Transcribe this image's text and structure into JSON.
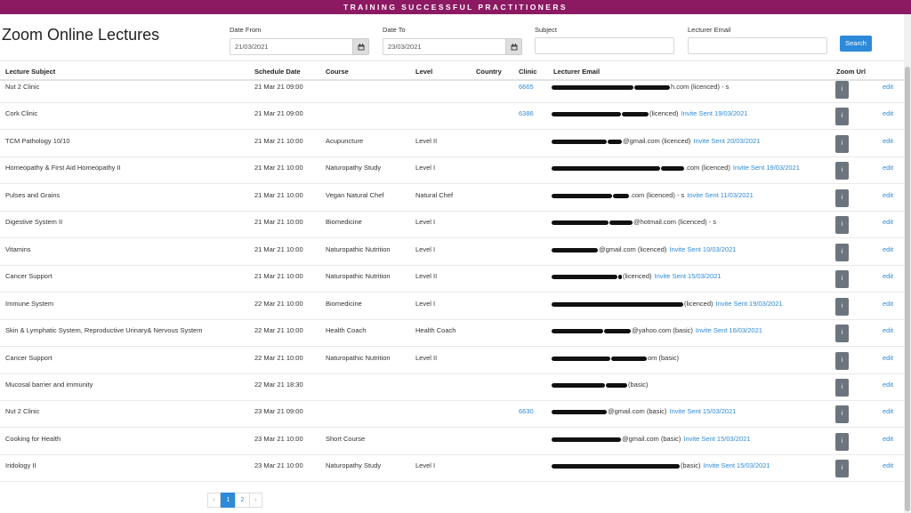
{
  "banner": "TRAINING SUCCESSFUL PRACTITIONERS",
  "page_title": "Zoom Online Lectures",
  "filters": {
    "date_from_label": "Date From",
    "date_from_value": "21/03/2021",
    "date_to_label": "Date To",
    "date_to_value": "23/03/2021",
    "subject_label": "Subject",
    "subject_value": "",
    "lecturer_email_label": "Lecturer Email",
    "lecturer_email_value": "",
    "search_label": "Search"
  },
  "columns": {
    "subject": "Lecture Subject",
    "date": "Schedule Date",
    "course": "Course",
    "level": "Level",
    "country": "Country",
    "clinic": "Clinic",
    "email": "Lecturer Email",
    "zoom": "Zoom Url"
  },
  "zoom_button_label": "i",
  "edit_label": "edit",
  "rows": [
    {
      "subject": "Nut 2 Clinic",
      "date": "21 Mar 21 09:00",
      "course": "",
      "level": "",
      "country": "",
      "clinic": "6665",
      "email_suffix": "h.com (licenced) - s",
      "invite": ""
    },
    {
      "subject": "Cork Clinic",
      "date": "21 Mar 21 09:00",
      "course": "",
      "level": "",
      "country": "",
      "clinic": "6386",
      "email_suffix": "(licenced)",
      "invite": "Invite Sent 19/03/2021"
    },
    {
      "subject": "TCM Pathology 10/10",
      "date": "21 Mar 21 10:00",
      "course": "Acupuncture",
      "level": "Level II",
      "country": "",
      "clinic": "",
      "email_suffix": "@gmail.com (licenced)",
      "invite": "Invite Sent 20/03/2021"
    },
    {
      "subject": "Homeopathy & First Aid Homeopathy II",
      "date": "21 Mar 21 10:00",
      "course": "Naturopathy Study",
      "level": "Level I",
      "country": "",
      "clinic": "",
      "email_suffix": ".com (licenced)",
      "invite": "Invite Sent 19/03/2021"
    },
    {
      "subject": "Pulses and Grains",
      "date": "21 Mar 21 10:00",
      "course": "Vegan Natural Chef",
      "level": "Natural Chef",
      "country": "",
      "clinic": "",
      "email_suffix": ".com (licenced) - s",
      "invite": "Invite Sent 11/03/2021"
    },
    {
      "subject": "Digestive System II",
      "date": "21 Mar 21 10:00",
      "course": "Biomedicine",
      "level": "Level I",
      "country": "",
      "clinic": "",
      "email_suffix": "@hotmail.com (licenced) - s",
      "invite": ""
    },
    {
      "subject": "Vitamins",
      "date": "21 Mar 21 10:00",
      "course": "Naturopathic Nutrition",
      "level": "Level I",
      "country": "",
      "clinic": "",
      "email_suffix": "@gmail.com (licenced)",
      "invite": "Invite Sent 10/03/2021"
    },
    {
      "subject": "Cancer Support",
      "date": "21 Mar 21 10:00",
      "course": "Naturopathic Nutrition",
      "level": "Level II",
      "country": "",
      "clinic": "",
      "email_suffix": "(licenced)",
      "invite": "Invite Sent 15/03/2021"
    },
    {
      "subject": "Immune System",
      "date": "22 Mar 21 10:00",
      "course": "Biomedicine",
      "level": "Level I",
      "country": "",
      "clinic": "",
      "email_suffix": "(licenced)",
      "invite": "Invite Sent 19/03/2021"
    },
    {
      "subject": "Skin & Lymphatic System, Reproductive Urinary& Nervous System",
      "date": "22 Mar 21 10:00",
      "course": "Health Coach",
      "level": "Health Coach",
      "country": "",
      "clinic": "",
      "email_suffix": "@yahoo.com (basic)",
      "invite": "Invite Sent 16/03/2021"
    },
    {
      "subject": "Cancer Support",
      "date": "22 Mar 21 10:00",
      "course": "Naturopathic Nutrition",
      "level": "Level II",
      "country": "",
      "clinic": "",
      "email_suffix": "om (basic)",
      "invite": ""
    },
    {
      "subject": "Mucosal barrier and immunity",
      "date": "22 Mar 21 18:30",
      "course": "",
      "level": "",
      "country": "",
      "clinic": "",
      "email_suffix": "(basic)",
      "invite": ""
    },
    {
      "subject": "Nut 2 Clinic",
      "date": "23 Mar 21 09:00",
      "course": "",
      "level": "",
      "country": "",
      "clinic": "6630",
      "email_suffix": "@gmail.com (basic)",
      "invite": "Invite Sent 15/03/2021"
    },
    {
      "subject": "Cooking for Health",
      "date": "23 Mar 21 10:00",
      "course": "Short Course",
      "level": "",
      "country": "",
      "clinic": "",
      "email_suffix": "@gmail.com (basic)",
      "invite": "Invite Sent 15/03/2021"
    },
    {
      "subject": "Iridology II",
      "date": "23 Mar 21 10:00",
      "course": "Naturopathy Study",
      "level": "Level I",
      "country": "",
      "clinic": "",
      "email_suffix": "(basic)",
      "invite": "Invite Sent 15/03/2021"
    }
  ],
  "pagination": {
    "prev": "‹",
    "pages": [
      "1",
      "2"
    ],
    "next": "›",
    "active": "1"
  }
}
